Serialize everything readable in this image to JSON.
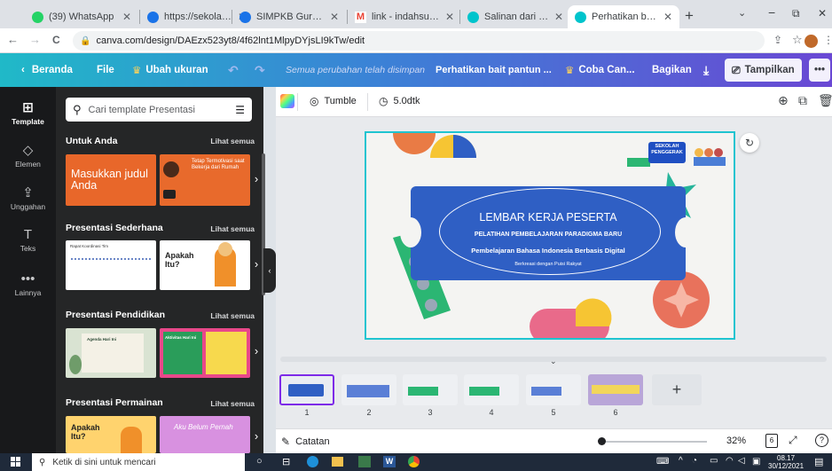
{
  "browser": {
    "tabs": [
      {
        "title": "(39) WhatsApp",
        "favicon_color": "#25d366"
      },
      {
        "title": "https://sekolah.pengg",
        "favicon_color": "#1a73e8"
      },
      {
        "title": "SIMPKB Guru Pengge",
        "favicon_color": "#1a73e8"
      },
      {
        "title": "link - indahsugiyarti0",
        "favicon_color": "#ea4335"
      },
      {
        "title": "Salinan dari Perhatika",
        "favicon_color": "#00c4cc"
      },
      {
        "title": "Perhatikan bait pantu",
        "favicon_color": "#00c4cc",
        "active": true
      }
    ],
    "new_tab": "+",
    "window_controls": {
      "minimize": "−",
      "restore": "⧉",
      "close": "✕",
      "list": "⌄"
    },
    "url": "canva.com/design/DAEzx523yt8/4f62lnt1MlpyDYjsLI9kTw/edit",
    "nav": {
      "back": "←",
      "forward": "→",
      "reload": "C"
    }
  },
  "canva_header": {
    "home": "Beranda",
    "file": "File",
    "resize": "Ubah ukuran",
    "saved_status": "Semua perubahan telah disimpan",
    "doc_title": "Perhatikan bait pantun ...",
    "try_pro": "Coba Can...",
    "share": "Bagikan",
    "present": "Tampilkan",
    "more": "•••"
  },
  "rail": [
    {
      "label": "Template",
      "icon": "template-icon",
      "glyph": "⊞"
    },
    {
      "label": "Elemen",
      "icon": "elements-icon",
      "glyph": "◇"
    },
    {
      "label": "Unggahan",
      "icon": "upload-icon",
      "glyph": "⇪"
    },
    {
      "label": "Teks",
      "icon": "text-icon",
      "glyph": "T"
    },
    {
      "label": "Lainnya",
      "icon": "more-icon",
      "glyph": "•••"
    }
  ],
  "panel": {
    "search_placeholder": "Cari template Presentasi",
    "see_all": "Lihat semua",
    "sections": [
      {
        "title": "Untuk Anda",
        "thumbs": [
          {
            "text": "Masukkan judul Anda",
            "bg": "#e8672a"
          },
          {
            "text": "Tetap Termotivasi saat Bekerja dari Rumah",
            "bg": "#e86a2c"
          }
        ]
      },
      {
        "title": "Presentasi Sederhana",
        "thumbs": [
          {
            "text": "Rapat Koordinasi Tim",
            "bg": "#ffffff"
          },
          {
            "text": "Apakah Itu?",
            "bg": "#ffffff"
          }
        ]
      },
      {
        "title": "Presentasi Pendidikan",
        "thumbs": [
          {
            "text": "Agenda Hari Ini",
            "bg": "#d9e3d2"
          },
          {
            "text": "Aktivitas Hari Ini",
            "bg": "#e9488a"
          }
        ]
      },
      {
        "title": "Presentasi Permainan",
        "thumbs": [
          {
            "text": "Apakah Itu?",
            "bg": "#ffd36e"
          },
          {
            "text": "Aku Belum Pernah",
            "bg": "#d891e0"
          }
        ]
      }
    ]
  },
  "toolbar": {
    "animation": "Tumble",
    "duration": "5.0dtk"
  },
  "slide": {
    "title": "LEMBAR KERJA PESERTA",
    "line1": "PELATIHAN PEMBELAJARAN PARADIGMA BARU",
    "line2": "Pembelajaran Bahasa Indonesia Berbasis Digital",
    "line3": "Berkreasi dengan Puisi Rakyat",
    "badge_text": "SEKOLAH PENGGERAK",
    "ticket_color": "#2f5fc4"
  },
  "pages": {
    "numbers": [
      "1",
      "2",
      "3",
      "4",
      "5",
      "6"
    ],
    "add": "+"
  },
  "bottombar": {
    "notes": "Catatan",
    "zoom": "32%",
    "page_count": "6",
    "help": "?"
  },
  "taskbar": {
    "search": "Ketik di sini untuk mencari",
    "time": "08.17",
    "date": "30/12/2021"
  },
  "colors": {
    "accent_cyan": "#1fc4d0",
    "canva_purple": "#6a48d4",
    "canva_teal": "#20b9c8"
  }
}
